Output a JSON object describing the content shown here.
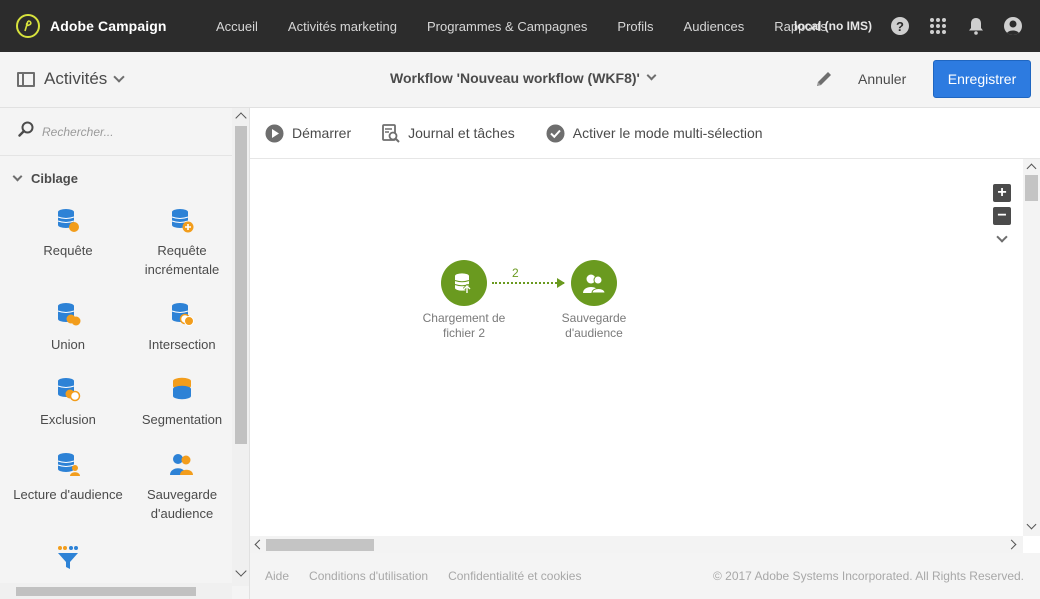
{
  "app": {
    "name": "Adobe Campaign"
  },
  "nav": {
    "items": [
      "Accueil",
      "Activités marketing",
      "Programmes & Campagnes",
      "Profils",
      "Audiences",
      "Rapports"
    ],
    "environment": "local (no IMS)",
    "help_glyph": "?"
  },
  "header": {
    "panel_title": "Activités",
    "workflow_title": "Workflow 'Nouveau workflow (WKF8)'",
    "cancel_label": "Annuler",
    "save_label": "Enregistrer"
  },
  "sidebar": {
    "search_placeholder": "Rechercher...",
    "section_title": "Ciblage",
    "activities": [
      {
        "label": "Requête",
        "icon": "query-icon"
      },
      {
        "label": "Requête incrémentale",
        "icon": "incremental-query-icon"
      },
      {
        "label": "Union",
        "icon": "union-icon"
      },
      {
        "label": "Intersection",
        "icon": "intersection-icon"
      },
      {
        "label": "Exclusion",
        "icon": "exclusion-icon"
      },
      {
        "label": "Segmentation",
        "icon": "segmentation-icon"
      },
      {
        "label": "Lecture d'audience",
        "icon": "read-audience-icon"
      },
      {
        "label": "Sauvegarde d'audience",
        "icon": "save-audience-icon"
      },
      {
        "label": "",
        "icon": "filter-icon"
      }
    ]
  },
  "toolbar": {
    "start_label": "Démarrer",
    "journal_label": "Journal et tâches",
    "multiselect_label": "Activer le mode multi-sélection"
  },
  "canvas": {
    "nodes": [
      {
        "label": "Chargement de fichier 2",
        "icon": "file-load-icon"
      },
      {
        "label": "Sauvegarde d'audience",
        "icon": "save-audience-icon"
      }
    ],
    "transition_count": "2",
    "zoom_in": "+",
    "zoom_out": "−"
  },
  "footer": {
    "links": [
      "Aide",
      "Conditions d'utilisation",
      "Confidentialité et cookies"
    ],
    "copyright": "© 2017 Adobe Systems Incorporated. All Rights Reserved."
  },
  "colors": {
    "topbar": "#2c2c2c",
    "accent": "#2d7be0",
    "node_green": "#6a9a1f",
    "icon_blue": "#2d82d6",
    "icon_orange": "#f29d1c"
  }
}
